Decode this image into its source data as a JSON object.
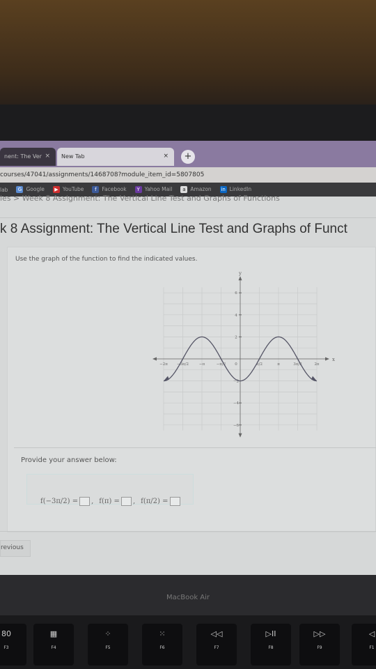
{
  "browser": {
    "tabs": [
      {
        "label": "nent: The Ver"
      },
      {
        "label": "New Tab"
      }
    ],
    "close_glyph": "×",
    "new_tab_glyph": "+",
    "url": "courses/47041/assignments/1468708?module_item_id=5807805",
    "bookmarks": [
      {
        "label": "lab",
        "icon": ""
      },
      {
        "label": "Google",
        "icon": "G",
        "color": "#5a8ad0"
      },
      {
        "label": "YouTube",
        "icon": "▶",
        "color": "#d03030"
      },
      {
        "label": "Facebook",
        "icon": "f",
        "color": "#3b5998"
      },
      {
        "label": "Yahoo Mail",
        "icon": "Y",
        "color": "#6a3aa0"
      },
      {
        "label": "Amazon",
        "icon": "a",
        "color": "#ddd"
      },
      {
        "label": "LinkedIn",
        "icon": "in",
        "color": "#0a66c2"
      }
    ]
  },
  "page": {
    "breadcrumb": "ies  >  Week 8 Assignment: The Vertical Line Test and Graphs of Functions",
    "title": "k 8 Assignment: The Vertical Line Test and Graphs of Funct",
    "prompt": "Use the graph of the function to find the indicated values.",
    "answer_label": "Provide your answer below:",
    "equations": [
      {
        "lhs": "f(−3π/2) =",
        "sep": ","
      },
      {
        "lhs": "f(π) =",
        "sep": ","
      },
      {
        "lhs": "f(π/2) =",
        "sep": ""
      }
    ],
    "previous_button": "revious"
  },
  "graph": {
    "x_label": "x",
    "y_label": "y",
    "x_ticks": [
      "−2π",
      "−3π/2",
      "−π",
      "−π/2",
      "0",
      "π/2",
      "π",
      "3π/2",
      "2π"
    ],
    "y_ticks": [
      "6",
      "4",
      "2",
      "−2",
      "−4",
      "−6"
    ],
    "function_shown": "-2cos(x)",
    "x_range": [
      "-2π",
      "2π"
    ],
    "y_range": [
      -6,
      6
    ],
    "curve_color": "#555566"
  },
  "laptop": {
    "brand": "MacBook Air",
    "keys": [
      {
        "glyph": "80",
        "label": "F3"
      },
      {
        "glyph": "▦",
        "label": "F4"
      },
      {
        "glyph": "⁘",
        "label": "F5"
      },
      {
        "glyph": "⁙",
        "label": "F6"
      },
      {
        "glyph": "◁◁",
        "label": "F7"
      },
      {
        "glyph": "▷II",
        "label": "F8"
      },
      {
        "glyph": "▷▷",
        "label": "F9"
      },
      {
        "glyph": "◁",
        "label": "F1"
      }
    ]
  }
}
